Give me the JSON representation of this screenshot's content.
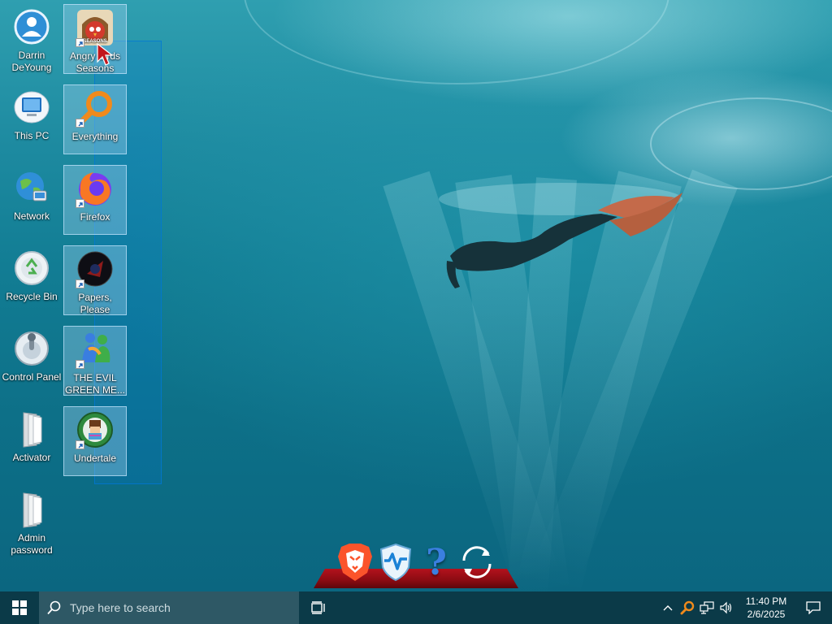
{
  "desktop": {
    "icons": [
      {
        "label": "Darrin DeYoung",
        "icon": "user-folder-icon"
      },
      {
        "label": "This PC",
        "icon": "computer-icon"
      },
      {
        "label": "Network",
        "icon": "network-globe-icon"
      },
      {
        "label": "Recycle Bin",
        "icon": "recycle-bin-icon"
      },
      {
        "label": "Control Panel",
        "icon": "control-panel-icon"
      },
      {
        "label": "Activator",
        "icon": "folder-icon"
      },
      {
        "label": "Admin password",
        "icon": "folder-icon"
      },
      {
        "label": "Angry Birds Seasons",
        "icon": "angry-birds-icon",
        "badge_text": "SEASONS"
      },
      {
        "label": "Everything",
        "icon": "everything-search-icon"
      },
      {
        "label": "Firefox",
        "icon": "firefox-icon"
      },
      {
        "label": "Papers, Please",
        "icon": "papers-please-icon"
      },
      {
        "label": "THE EVIL GREEN ME...",
        "icon": "messenger-people-icon"
      },
      {
        "label": "Undertale",
        "icon": "undertale-icon"
      }
    ]
  },
  "dock": {
    "items": [
      {
        "name": "brave-browser",
        "icon": "brave-lion-icon"
      },
      {
        "name": "wise-care",
        "icon": "wise-shield-icon"
      },
      {
        "name": "help",
        "icon": "question-mark-icon",
        "glyph": "?"
      },
      {
        "name": "refresh",
        "icon": "refresh-icon"
      }
    ]
  },
  "taskbar": {
    "search_placeholder": "Type here to search",
    "clock": {
      "time": "11:40 PM",
      "date": "2/6/2025"
    }
  },
  "colors": {
    "taskbar_bg": "#0b3a48",
    "search_bg": "#2e5865",
    "selection": "#0078d7",
    "dock_shelf": "#b3121d"
  }
}
